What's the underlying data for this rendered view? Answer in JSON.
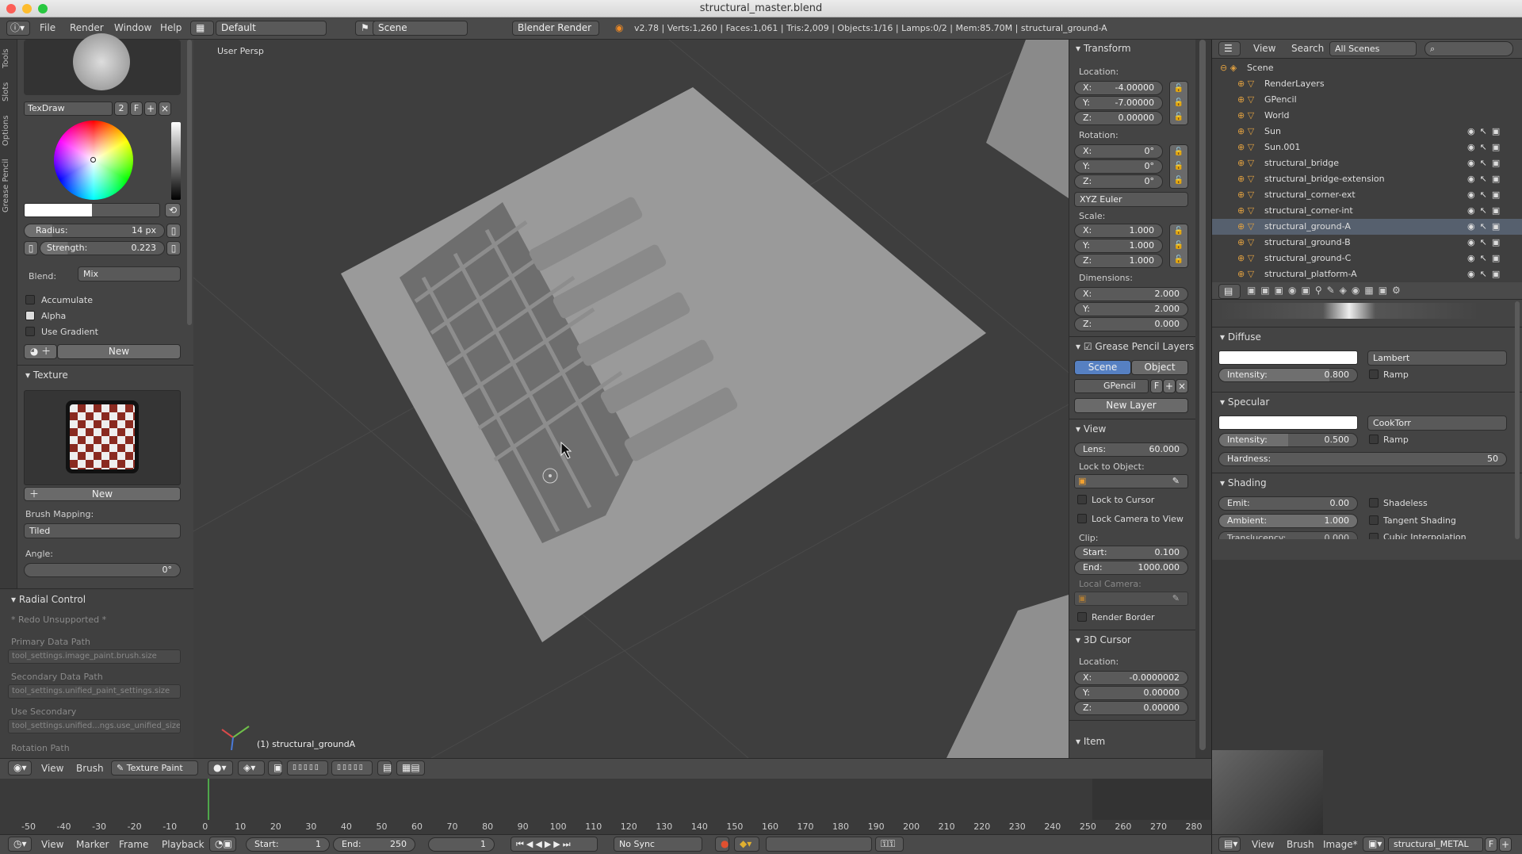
{
  "window": {
    "title": "structural_master.blend"
  },
  "infobar": {
    "menus": [
      "File",
      "Render",
      "Window",
      "Help"
    ],
    "layout": "Default",
    "scene": "Scene",
    "engine": "Blender Render",
    "stats": "v2.78 | Verts:1,260 | Faces:1,061 | Tris:2,009 | Objects:1/16 | Lamps:0/2 | Mem:85.70M | structural_ground-A"
  },
  "toolshelf": {
    "tabs": [
      "Tools",
      "Slots",
      "Options",
      "Grease Pencil"
    ],
    "brush_name": "TexDraw",
    "brush_users": "2",
    "brush_fake": "F",
    "radius_label": "Radius:",
    "radius_value": "14 px",
    "strength_label": "Strength:",
    "strength_value": "0.223",
    "blend_label": "Blend:",
    "blend_value": "Mix",
    "accumulate": "Accumulate",
    "alpha": "Alpha",
    "use_gradient": "Use Gradient",
    "new_button": "New",
    "texture_header": "Texture",
    "texture_new": "New",
    "brush_mapping_label": "Brush Mapping:",
    "brush_mapping_value": "Tiled",
    "angle_label": "Angle:",
    "angle_value": "0°"
  },
  "radial": {
    "header": "Radial Control",
    "redo": "* Redo Unsupported *",
    "primary_label": "Primary Data Path",
    "primary_value": "tool_settings.image_paint.brush.size",
    "secondary_label": "Secondary Data Path",
    "secondary_value": "tool_settings.unified_paint_settings.size",
    "use_secondary_label": "Use Secondary",
    "use_secondary_value": "tool_settings.unified...ngs.use_unified_size",
    "rotation_label": "Rotation Path"
  },
  "viewport": {
    "view_name": "User Persp",
    "object_label": "(1) structural_groundA"
  },
  "npanel": {
    "transform_header": "Transform",
    "location_label": "Location:",
    "loc": [
      {
        "a": "X:",
        "v": "-4.00000"
      },
      {
        "a": "Y:",
        "v": "-7.00000"
      },
      {
        "a": "Z:",
        "v": "0.00000"
      }
    ],
    "rotation_label": "Rotation:",
    "rot": [
      {
        "a": "X:",
        "v": "0°"
      },
      {
        "a": "Y:",
        "v": "0°"
      },
      {
        "a": "Z:",
        "v": "0°"
      }
    ],
    "rotation_mode": "XYZ Euler",
    "scale_label": "Scale:",
    "scale": [
      {
        "a": "X:",
        "v": "1.000"
      },
      {
        "a": "Y:",
        "v": "1.000"
      },
      {
        "a": "Z:",
        "v": "1.000"
      }
    ],
    "dimensions_label": "Dimensions:",
    "dims": [
      {
        "a": "X:",
        "v": "2.000"
      },
      {
        "a": "Y:",
        "v": "2.000"
      },
      {
        "a": "Z:",
        "v": "0.000"
      }
    ],
    "gp_header": "Grease Pencil Layers",
    "gp_scene": "Scene",
    "gp_object": "Object",
    "gp_name": "GPencil",
    "gp_f": "F",
    "gp_new_layer": "New Layer",
    "view_header": "View",
    "lens_label": "Lens:",
    "lens_value": "60.000",
    "lock_obj_label": "Lock to Object:",
    "lock_cursor": "Lock to Cursor",
    "lock_camera": "Lock Camera to View",
    "clip_label": "Clip:",
    "clip_start_label": "Start:",
    "clip_start": "0.100",
    "clip_end_label": "End:",
    "clip_end": "1000.000",
    "local_camera": "Local Camera:",
    "render_border": "Render Border",
    "cursor_header": "3D Cursor",
    "cursor_loc_label": "Location:",
    "cursor": [
      {
        "a": "X:",
        "v": "-0.0000002"
      },
      {
        "a": "Y:",
        "v": "0.00000"
      },
      {
        "a": "Z:",
        "v": "0.00000"
      }
    ],
    "item_header": "Item"
  },
  "outliner": {
    "view": "View",
    "search": "Search",
    "filter": "All Scenes",
    "items": [
      {
        "name": "Scene",
        "indent": 0
      },
      {
        "name": "RenderLayers",
        "indent": 1
      },
      {
        "name": "GPencil",
        "indent": 1
      },
      {
        "name": "World",
        "indent": 1
      },
      {
        "name": "Sun",
        "indent": 1
      },
      {
        "name": "Sun.001",
        "indent": 1
      },
      {
        "name": "structural_bridge",
        "indent": 1
      },
      {
        "name": "structural_bridge-extension",
        "indent": 1
      },
      {
        "name": "structural_corner-ext",
        "indent": 1
      },
      {
        "name": "structural_corner-int",
        "indent": 1
      },
      {
        "name": "structural_ground-A",
        "indent": 1
      },
      {
        "name": "structural_ground-B",
        "indent": 1
      },
      {
        "name": "structural_ground-C",
        "indent": 1
      },
      {
        "name": "structural_platform-A",
        "indent": 1
      }
    ]
  },
  "props": {
    "diffuse_header": "Diffuse",
    "diffuse_shader": "Lambert",
    "diffuse_int_label": "Intensity:",
    "diffuse_int": "0.800",
    "ramp": "Ramp",
    "specular_header": "Specular",
    "spec_shader": "CookTorr",
    "spec_int_label": "Intensity:",
    "spec_int": "0.500",
    "hardness_label": "Hardness:",
    "hardness": "50",
    "shading_header": "Shading",
    "emit_label": "Emit:",
    "emit": "0.00",
    "ambient_label": "Ambient:",
    "ambient": "1.000",
    "translucency_label": "Translucency:",
    "translucency": "0.000",
    "shadeless": "Shadeless",
    "tangent": "Tangent Shading",
    "cubic": "Cubic Interpolation"
  },
  "vpheader": {
    "view": "View",
    "brush": "Brush",
    "mode": "Texture Paint"
  },
  "timeline": {
    "ticks": [
      "-50",
      "-40",
      "-30",
      "-20",
      "-10",
      "0",
      "10",
      "20",
      "30",
      "40",
      "50",
      "60",
      "70",
      "80",
      "90",
      "100",
      "110",
      "120",
      "130",
      "140",
      "150",
      "160",
      "170",
      "180",
      "190",
      "200",
      "210",
      "220",
      "230",
      "240",
      "250",
      "260",
      "270",
      "280"
    ],
    "menus": [
      "View",
      "Marker",
      "Frame",
      "Playback"
    ],
    "start_label": "Start:",
    "start": "1",
    "end_label": "End:",
    "end": "250",
    "current": "1",
    "sync": "No Sync"
  },
  "imgedit": {
    "view": "View",
    "brush": "Brush",
    "image": "Image*",
    "image_name": "structural_METAL",
    "f": "F"
  }
}
